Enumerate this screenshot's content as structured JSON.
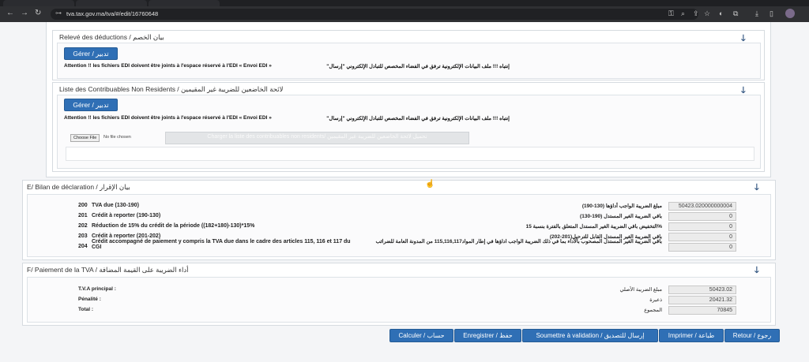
{
  "browser": {
    "url": "tva.tax.gov.ma/tva/#/edit/16760648"
  },
  "deductions": {
    "title": "Relevé des déductions / بيان الخصم",
    "gerer_label": "Gérer / تدبير",
    "warning_fr": "Attention !! les fichiers EDI doivent être joints à l'espace réservé à l'EDI « Envoi EDI »",
    "warning_ar": "إنتباه !!! ملف البيانات الإلكترونية ترفق في الفضاء المخصص للتبادل الإلكتروني \"إرسال\""
  },
  "non_residents": {
    "title": "Liste des Contribuables Non Residents / لائحة الخاضعين للضريبة غير المقيمين",
    "gerer_label": "Gérer / تدبير",
    "warning_fr": "Attention !! les fichiers EDI doivent être joints à l'espace réservé à l'EDI « Envoi EDI »",
    "warning_ar": "إنتباه !!! ملف البيانات الإلكترونية ترفق في الفضاء المخصص للتبادل الإلكتروني \"إرسال\"",
    "choose_file_label": "Choose File",
    "no_file_label": "No file chosen",
    "charger_label": "Charger la liste des contribuables non residents/ تحميل لائحة الخاضعين للضريبة غير المقيمين"
  },
  "bilan": {
    "title": "E/ Bilan de déclaration / بيان الإقرار",
    "rows": [
      {
        "num": "200",
        "fr": "TVA due (130-190)",
        "ar": "مبلغ الضريبة الواجب أداؤها (130-190)",
        "value": "50423.020000000004"
      },
      {
        "num": "201",
        "fr": "Crédit à reporter (190-130)",
        "ar": "باقي الضريبة الغير المستدل (190-130)",
        "value": "0"
      },
      {
        "num": "202",
        "fr": "Réduction de 15% du crédit de la période ((182+180)-130)*15%",
        "ar": "%التخفيض باقي الضريبة الغير المستدل المتعلق بالفترة بنسبة 15",
        "value": "0"
      },
      {
        "num": "203",
        "fr": "Crédit à reporter (201-202)",
        "ar": "باقي الضريبة الغير المستدل القابل للترحيل(201-202)",
        "value": "0"
      },
      {
        "num": "204",
        "fr": "Crédit accompagné de paiement y compris la TVA due dans le cadre des articles 115, 116 et 117 du CGI",
        "ar": "باقي الضريبة الغير المستدل المصحوب بالأداء بما في ذلك الضريبة الواجب اداؤها في إطار المواد115,116,117 من المدونة العامة للضرائب",
        "value": "0"
      }
    ]
  },
  "paiement": {
    "title": "F/ Paiement de la TVA / أداء الضريبة على القيمة المضافة",
    "rows": [
      {
        "fr": "T.V.A principal :",
        "ar": "مبلغ الضريبة الأصلي",
        "value": "50423.02"
      },
      {
        "fr": "Pénalité :",
        "ar": "ذعيرة",
        "value": "20421.32"
      },
      {
        "fr": "Total :",
        "ar": "المجموع",
        "value": "70845"
      }
    ]
  },
  "actions": {
    "calculer": "Calculer / حساب",
    "enregistrer": "Enregistrer / حفظ",
    "soumettre": "Soumettre à validation / إرسال للتصديق",
    "imprimer": "Imprimer / طباعة",
    "retour": "Retour / رجوع"
  },
  "colors": {
    "button_blue": "#2f6fb5",
    "arrow_navy": "#2a4f7c"
  }
}
